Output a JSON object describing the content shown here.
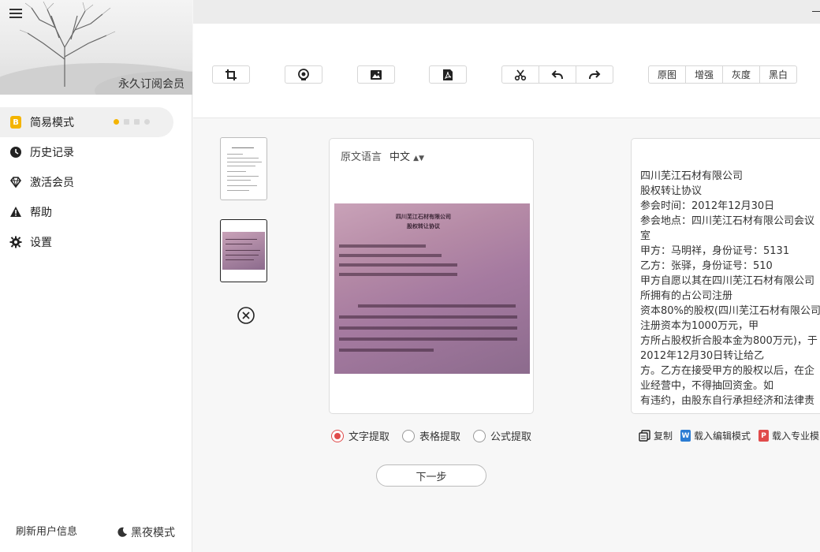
{
  "sidebar": {
    "subscription_label": "永久订阅会员",
    "items": [
      {
        "label": "简易模式",
        "icon": "b-badge-icon",
        "active": true
      },
      {
        "label": "历史记录",
        "icon": "clock-icon"
      },
      {
        "label": "激活会员",
        "icon": "diamond-icon"
      },
      {
        "label": "帮助",
        "icon": "warning-icon"
      },
      {
        "label": "设置",
        "icon": "gear-icon"
      }
    ],
    "badge_letter": "B",
    "refresh_label": "刷新用户信息",
    "night_mode_label": "黑夜模式"
  },
  "toolbar": {
    "buttons": [
      "crop-icon",
      "camera-icon",
      "image-icon",
      "pdf-icon"
    ],
    "edit_group": [
      "scissors-icon",
      "undo-icon",
      "redo-icon"
    ],
    "filter_modes": [
      "原图",
      "增强",
      "灰度",
      "黑白"
    ]
  },
  "source": {
    "lang_label": "原文语言",
    "lang_value": "中文",
    "doc_title1": "四川芜江石材有限公司",
    "doc_title2": "股权转让协议"
  },
  "result": {
    "lines": [
      "四川芜江石材有限公司",
      "股权转让协议",
      "参会时间：2012年12月30日",
      "参会地点：四川芜江石材有限公司会议室",
      "甲方：马明祥，身份证号：5131",
      "乙方：张驿，身份证号：510",
      "甲方自愿以其在四川芜江石材有限公司所拥有的占公司注册",
      "资本80%的股权(四川芜江石材有限公司注册资本为1000万元，甲",
      "方所占股权折合股本金为800万元)，于2012年12月30日转让给乙",
      "方。乙方在接受甲方的股权以后，在企业经营中，不得抽回资金。如",
      "有违约，由股东自行承担经济和法律责"
    ]
  },
  "extract_modes": [
    {
      "label": "文字提取",
      "selected": true
    },
    {
      "label": "表格提取",
      "selected": false
    },
    {
      "label": "公式提取",
      "selected": false
    }
  ],
  "next_label": "下一步",
  "actions": {
    "copy_label": "复制",
    "edit_label": "载入编辑模式",
    "pro_label": "载入专业模",
    "word_letter": "W",
    "pdf_letter": "P"
  },
  "colors": {
    "accent": "#e04b4b",
    "badge": "#f4b400",
    "word": "#2b7cd3",
    "pdf": "#e04b4b"
  }
}
